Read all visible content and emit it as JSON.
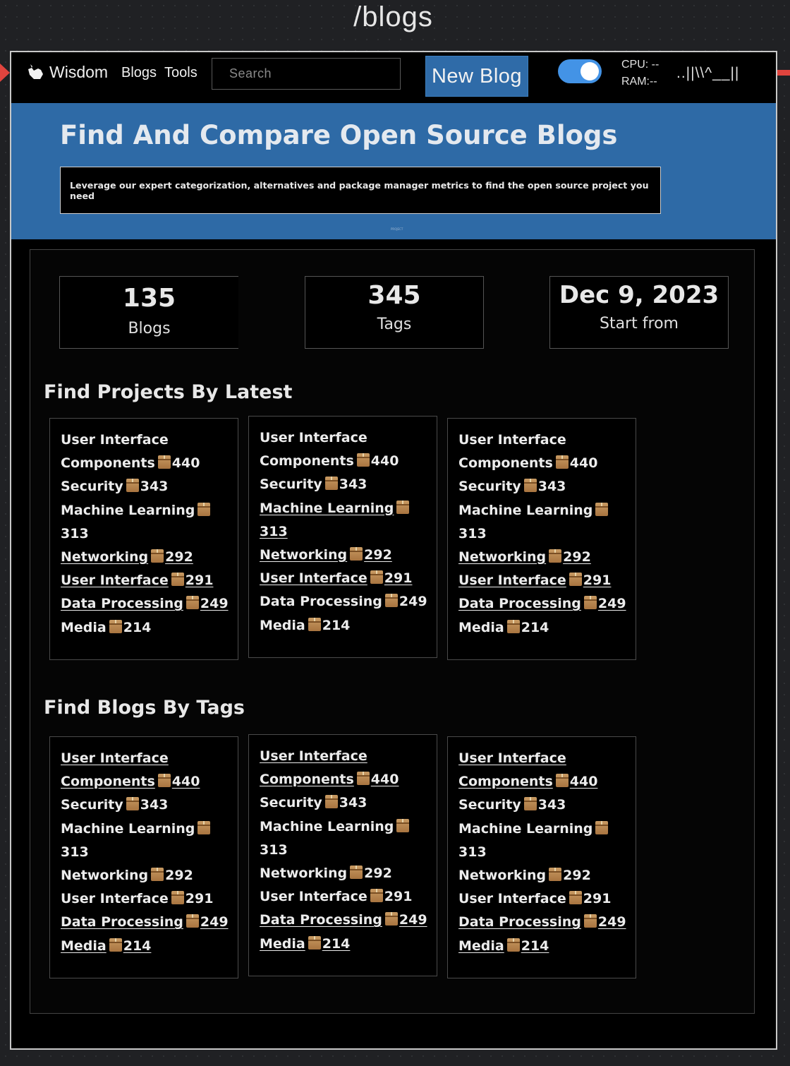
{
  "canvas": {
    "title": "/blogs"
  },
  "nav": {
    "logo_text": "Wisdom",
    "links": [
      "Blogs",
      "Tools"
    ],
    "search_placeholder": "Search",
    "new_blog_label": "New Blog",
    "toggle_on": true,
    "cpu": "CPU: --",
    "ram": "RAM:--",
    "ascii": "..||\\\\^__||"
  },
  "hero": {
    "title": "Find And Compare Open Source Blogs",
    "subtitle": "Leverage our expert categorization, alternatives and package manager metrics to find the open source project you need",
    "tiny": "PROJECT",
    "accent_color": "#2e6aa6"
  },
  "stats": [
    {
      "value": "135",
      "label": "Blogs"
    },
    {
      "value": "345",
      "label": "Tags"
    },
    {
      "value": "Dec 9, 2023",
      "label": "Start from"
    }
  ],
  "sections": {
    "latest_title": "Find Projects By Latest",
    "tags_title": "Find Blogs By Tags"
  },
  "latest_cards": [
    {
      "items": [
        {
          "label": "User Interface Components",
          "count": "440",
          "link": false
        },
        {
          "label": "Security",
          "count": "343",
          "link": false
        },
        {
          "label": "Machine Learning",
          "count": "313",
          "link": false
        },
        {
          "label": "Networking",
          "count": "292",
          "link": true
        },
        {
          "label": "User Interface",
          "count": "291",
          "link": true
        },
        {
          "label": "Data Processing",
          "count": "249",
          "link": true
        },
        {
          "label": "Media",
          "count": "214",
          "link": false
        }
      ]
    },
    {
      "items": [
        {
          "label": "User Interface Components",
          "count": "440",
          "link": false
        },
        {
          "label": "Security",
          "count": "343",
          "link": false
        },
        {
          "label": "Machine Learning",
          "count": "313",
          "link": true
        },
        {
          "label": "Networking",
          "count": "292",
          "link": true
        },
        {
          "label": "User Interface",
          "count": "291",
          "link": true
        },
        {
          "label": "Data Processing",
          "count": "249",
          "link": false
        },
        {
          "label": "Media",
          "count": "214",
          "link": false
        }
      ]
    },
    {
      "items": [
        {
          "label": "User Interface Components",
          "count": "440",
          "link": false
        },
        {
          "label": "Security",
          "count": "343",
          "link": false
        },
        {
          "label": "Machine Learning",
          "count": "313",
          "link": false
        },
        {
          "label": "Networking",
          "count": "292",
          "link": true
        },
        {
          "label": "User Interface",
          "count": "291",
          "link": true
        },
        {
          "label": "Data Processing",
          "count": "249",
          "link": true
        },
        {
          "label": "Media",
          "count": "214",
          "link": false
        }
      ]
    }
  ],
  "tag_cards": [
    {
      "items": [
        {
          "label": "User Interface Components",
          "count": "440",
          "link": true
        },
        {
          "label": "Security",
          "count": "343",
          "link": false
        },
        {
          "label": "Machine Learning",
          "count": "313",
          "link": false
        },
        {
          "label": "Networking",
          "count": "292",
          "link": false
        },
        {
          "label": "User Interface",
          "count": "291",
          "link": false
        },
        {
          "label": "Data Processing",
          "count": "249",
          "link": true
        },
        {
          "label": "Media",
          "count": "214",
          "link": true
        }
      ]
    },
    {
      "items": [
        {
          "label": "User Interface Components",
          "count": "440",
          "link": true
        },
        {
          "label": "Security",
          "count": "343",
          "link": false
        },
        {
          "label": "Machine Learning",
          "count": "313",
          "link": false
        },
        {
          "label": "Networking",
          "count": "292",
          "link": false
        },
        {
          "label": "User Interface",
          "count": "291",
          "link": false
        },
        {
          "label": "Data Processing",
          "count": "249",
          "link": true
        },
        {
          "label": "Media",
          "count": "214",
          "link": true
        }
      ]
    },
    {
      "items": [
        {
          "label": "User Interface Components",
          "count": "440",
          "link": true
        },
        {
          "label": "Security",
          "count": "343",
          "link": false
        },
        {
          "label": "Machine Learning",
          "count": "313",
          "link": false
        },
        {
          "label": "Networking",
          "count": "292",
          "link": false
        },
        {
          "label": "User Interface",
          "count": "291",
          "link": false
        },
        {
          "label": "Data Processing",
          "count": "249",
          "link": true
        },
        {
          "label": "Media",
          "count": "214",
          "link": true
        }
      ]
    }
  ],
  "icons": {
    "tag_count": "package-icon",
    "logo": "hand-logo-icon"
  }
}
